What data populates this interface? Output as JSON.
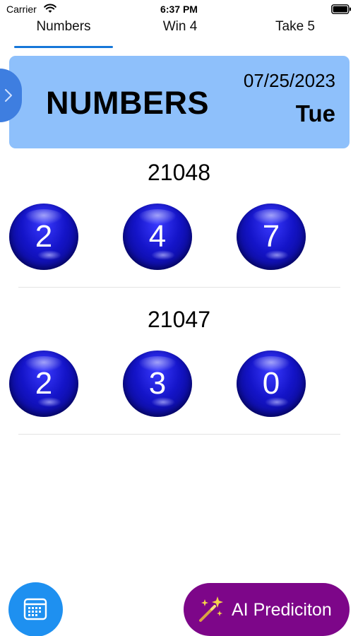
{
  "status_bar": {
    "carrier": "Carrier",
    "time": "6:37 PM"
  },
  "tabs": [
    {
      "label": "Numbers",
      "selected": true
    },
    {
      "label": "Win 4",
      "selected": false
    },
    {
      "label": "Take 5",
      "selected": false
    }
  ],
  "header": {
    "title": "NUMBERS",
    "date": "07/25/2023",
    "day": "Tue"
  },
  "draws": [
    {
      "draw_id": "21048",
      "digits": [
        "2",
        "4",
        "7"
      ]
    },
    {
      "draw_id": "21047",
      "digits": [
        "2",
        "3",
        "0"
      ]
    }
  ],
  "bottom": {
    "ai_button_label": "AI Prediciton"
  },
  "colors": {
    "accent": "#1677d9",
    "header_card": "#8ec0fb",
    "ball": "#1414c8",
    "calendar_button": "#1e90f0",
    "ai_button": "#7d0689"
  },
  "icons": {
    "wifi": "wifi-icon",
    "battery": "battery-icon",
    "side_toggle": "chevron-right-icon",
    "calendar": "calendar-icon",
    "ai": "sparkles-icon"
  }
}
